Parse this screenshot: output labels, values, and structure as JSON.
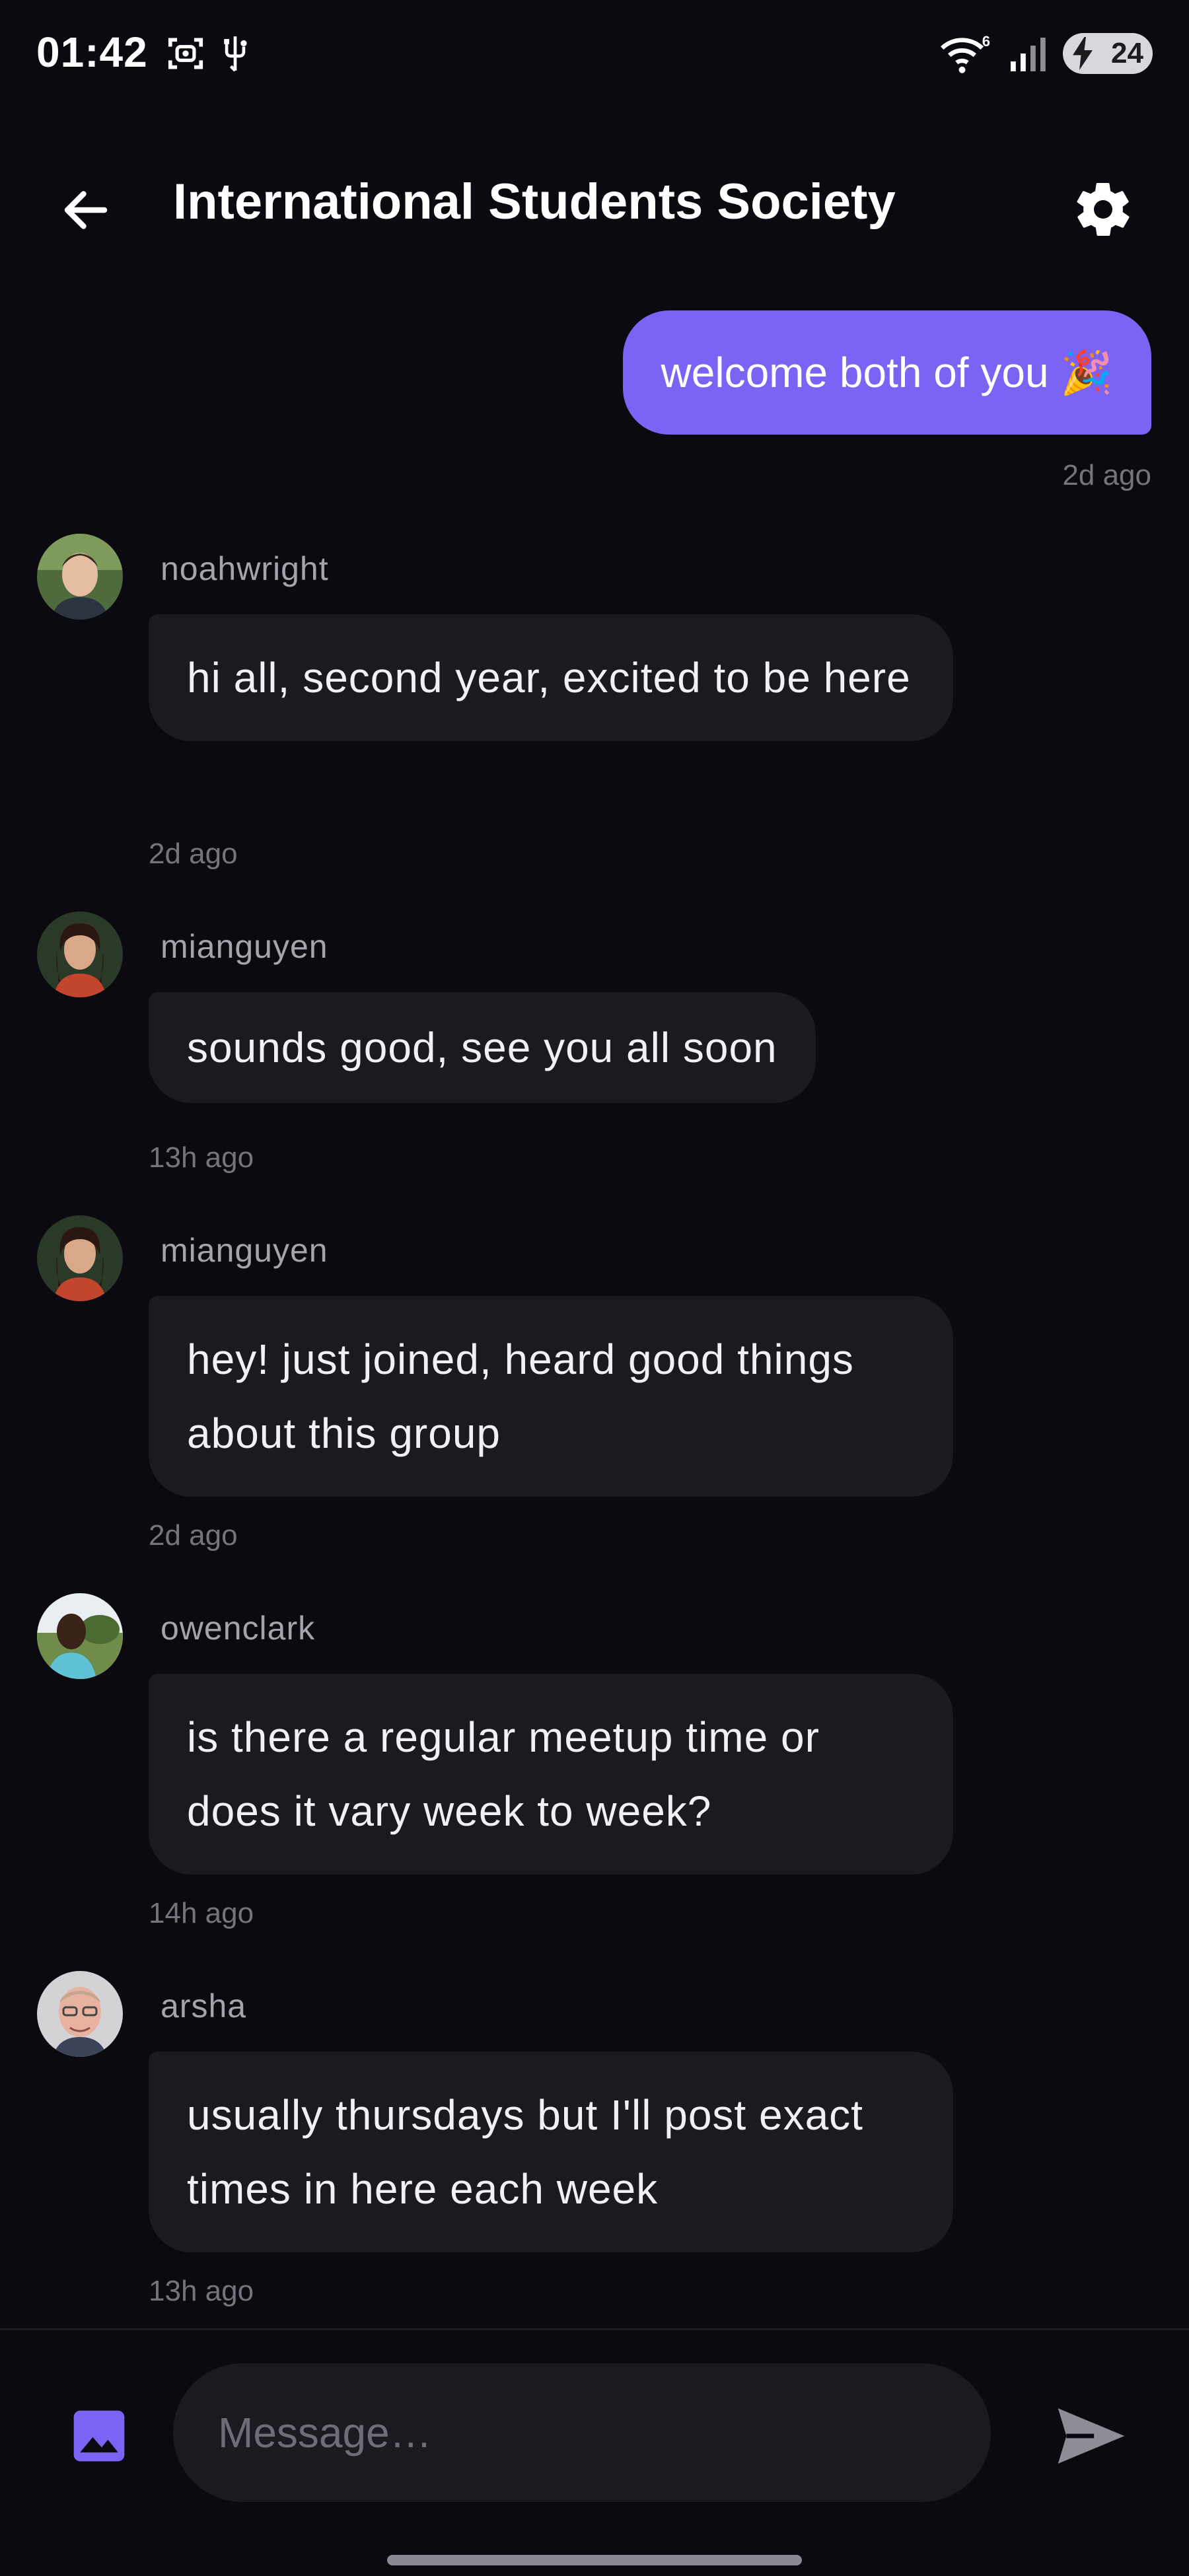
{
  "status_bar": {
    "time": "01:42",
    "battery_level": "24",
    "wifi_badge": "6"
  },
  "header": {
    "title": "International Students Society",
    "back_icon": "arrow-back-icon",
    "settings_icon": "gear-icon"
  },
  "own_message": {
    "text": "welcome both of you 🎉",
    "time": "2d ago",
    "bubble_color": "#7b63f4"
  },
  "messages": [
    {
      "username": "noahwright",
      "text": "hi all, second year, excited to be here",
      "time": "2d ago"
    },
    {
      "username": "mianguyen",
      "text": "sounds good, see you all soon",
      "time": "13h ago"
    },
    {
      "username": "mianguyen",
      "text": "hey! just joined, heard good things about this group",
      "time": "2d ago"
    },
    {
      "username": "owenclark",
      "text": "is there a regular meetup time or does it vary week to week?",
      "time": "14h ago"
    },
    {
      "username": "arsha",
      "text": "usually thursdays but I'll post exact times in here each week",
      "time": "13h ago"
    }
  ],
  "composer": {
    "placeholder": "Message…",
    "image_icon": "image-icon",
    "send_icon": "send-icon",
    "accent_color": "#7b63f4"
  }
}
